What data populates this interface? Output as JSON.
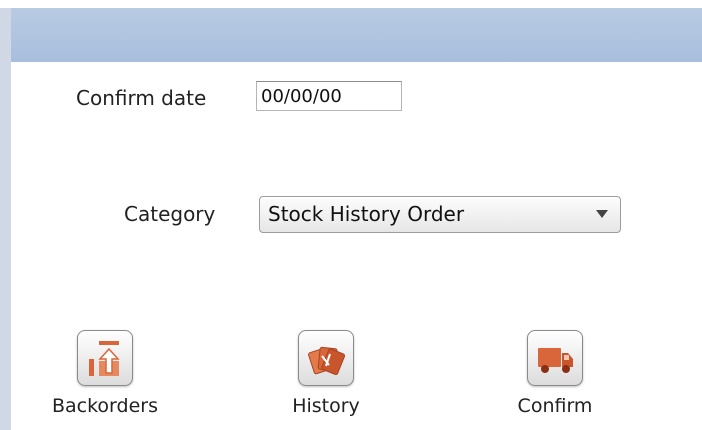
{
  "form": {
    "confirm_date_label": "Confirm date",
    "confirm_date_value": "00/00/00",
    "category_label": "Category",
    "category_selected": "Stock History Order"
  },
  "toolbar": {
    "backorders_label": "Backorders",
    "history_label": "History",
    "confirm_label": "Confirm"
  },
  "icons": {
    "backorders": "backorder-arrow-icon",
    "history": "history-cards-icon",
    "confirm": "delivery-truck-icon"
  },
  "colors": {
    "header": "#a8bede",
    "icon_accent": "#d9663a"
  }
}
